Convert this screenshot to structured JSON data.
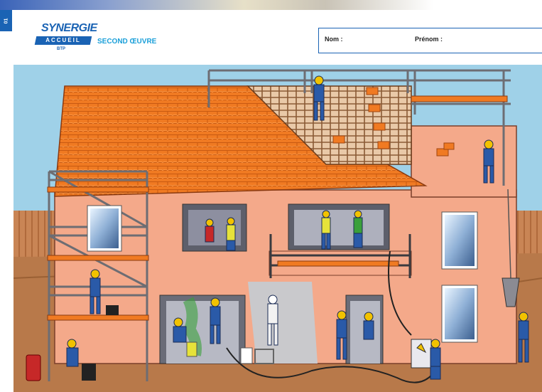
{
  "page_number": "01",
  "logo": {
    "title": "SYNERGIE",
    "band": "ACCUEIL",
    "sub": "BTP"
  },
  "subtitle": "SECOND ŒUVRE",
  "form": {
    "nom_label": "Nom :",
    "prenom_label": "Prénom :"
  },
  "colors": {
    "brand_blue": "#1a63b4",
    "accent_cyan": "#1a9fd9",
    "sky": "#9fd1e8",
    "wall": "#f4a98a",
    "roof": "#f07a22",
    "ground": "#b8794a",
    "scaffold": "#7b7b80",
    "workwear": "#2a5aa8",
    "hardhat": "#f2c200"
  },
  "illustration": {
    "subject": "house-construction-second-oeuvre"
  }
}
